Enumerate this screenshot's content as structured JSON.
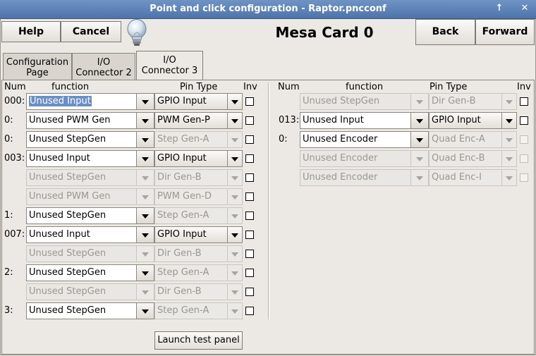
{
  "window": {
    "title": "Point and click configuration - Raptor.pncconf",
    "up_glyph": "↑",
    "close_glyph": "✕"
  },
  "toolbar": {
    "help": "Help",
    "cancel": "Cancel",
    "card_title": "Mesa Card 0",
    "back": "Back",
    "forward": "Forward"
  },
  "tabs": [
    {
      "line1": "Configuration",
      "line2": "Page"
    },
    {
      "line1": "I/O",
      "line2": "Connector 2"
    },
    {
      "line1": "I/O",
      "line2": "Connector 3"
    }
  ],
  "headers": {
    "num": "Num",
    "function": "function",
    "pin_type": "Pin Type",
    "inv": "Inv"
  },
  "left_rows": [
    {
      "num": "000:",
      "function": "Unused Input",
      "pin_type": "GPIO Input",
      "enabled": true,
      "selected": true
    },
    {
      "num": "0:",
      "function": "Unused PWM Gen",
      "pin_type": "PWM Gen-P",
      "enabled": true
    },
    {
      "num": "0:",
      "function": "Unused StepGen",
      "pin_type": "Step Gen-A",
      "enabled": true,
      "ptype_disabled": true
    },
    {
      "num": "003:",
      "function": "Unused Input",
      "pin_type": "GPIO Input",
      "enabled": true
    },
    {
      "num": "",
      "function": "Unused StepGen",
      "pin_type": "Dir Gen-B",
      "enabled": false
    },
    {
      "num": "",
      "function": "Unused PWM Gen",
      "pin_type": "PWM Gen-D",
      "enabled": false
    },
    {
      "num": "1:",
      "function": "Unused StepGen",
      "pin_type": "Step Gen-A",
      "enabled": true,
      "ptype_disabled": true
    },
    {
      "num": "007:",
      "function": "Unused Input",
      "pin_type": "GPIO Input",
      "enabled": true
    },
    {
      "num": "",
      "function": "Unused StepGen",
      "pin_type": "Dir Gen-B",
      "enabled": false
    },
    {
      "num": "2:",
      "function": "Unused StepGen",
      "pin_type": "Step Gen-A",
      "enabled": true,
      "ptype_disabled": true
    },
    {
      "num": "",
      "function": "Unused StepGen",
      "pin_type": "Dir Gen-B",
      "enabled": false
    },
    {
      "num": "3:",
      "function": "Unused StepGen",
      "pin_type": "Step Gen-A",
      "enabled": true,
      "ptype_disabled": true
    }
  ],
  "right_rows": [
    {
      "num": "",
      "function": "Unused StepGen",
      "pin_type": "Dir Gen-B",
      "enabled": false,
      "inv_enabled": true
    },
    {
      "num": "013:",
      "function": "Unused Input",
      "pin_type": "GPIO Input",
      "enabled": true,
      "inv_enabled": true
    },
    {
      "num": "0:",
      "function": "Unused Encoder",
      "pin_type": "Quad Enc-A",
      "enabled": true,
      "ptype_disabled": true,
      "inv_enabled": false
    },
    {
      "num": "",
      "function": "Unused Encoder",
      "pin_type": "Quad Enc-B",
      "enabled": false,
      "inv_enabled": false
    },
    {
      "num": "",
      "function": "Unused Encoder",
      "pin_type": "Quad Enc-I",
      "enabled": false,
      "inv_enabled": false
    }
  ],
  "launch_button": "Launch test panel"
}
